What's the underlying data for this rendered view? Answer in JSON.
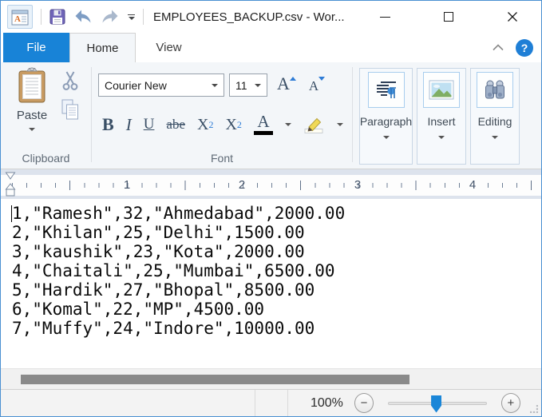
{
  "titlebar": {
    "title": "EMPLOYEES_BACKUP.csv - Wor..."
  },
  "tabs": {
    "file": "File",
    "home": "Home",
    "view": "View",
    "help_glyph": "?"
  },
  "ribbon": {
    "clipboard": {
      "paste": "Paste",
      "label": "Clipboard"
    },
    "font": {
      "label": "Font",
      "family": "Courier New",
      "size": "11",
      "grow": "A",
      "shrink": "A",
      "bold": "B",
      "italic": "I",
      "underline": "U",
      "strikethrough": "abe",
      "subscript": {
        "x": "X",
        "n": "2"
      },
      "superscript": {
        "x": "X",
        "n": "2"
      },
      "color_letter": "A"
    },
    "paragraph": {
      "label": "Paragraph"
    },
    "insert": {
      "label": "Insert"
    },
    "editing": {
      "label": "Editing"
    }
  },
  "ruler": {
    "marks": [
      "1",
      "2",
      "3",
      "4"
    ]
  },
  "document": {
    "lines": [
      "1,\"Ramesh\",32,\"Ahmedabad\",2000.00",
      "2,\"Khilan\",25,\"Delhi\",1500.00",
      "3,\"kaushik\",23,\"Kota\",2000.00",
      "4,\"Chaitali\",25,\"Mumbai\",6500.00",
      "5,\"Hardik\",27,\"Bhopal\",8500.00",
      "6,\"Komal\",22,\"MP\",4500.00",
      "7,\"Muffy\",24,\"Indore\",10000.00"
    ]
  },
  "statusbar": {
    "zoom": "100%",
    "zoom_out": "−",
    "zoom_in": "+"
  },
  "colors": {
    "accent_blue": "#1883d7",
    "slider_thumb": "#1a86d8",
    "font_color_swatch": "#000000",
    "scrollbar_thumb": "#8a8a8a"
  }
}
